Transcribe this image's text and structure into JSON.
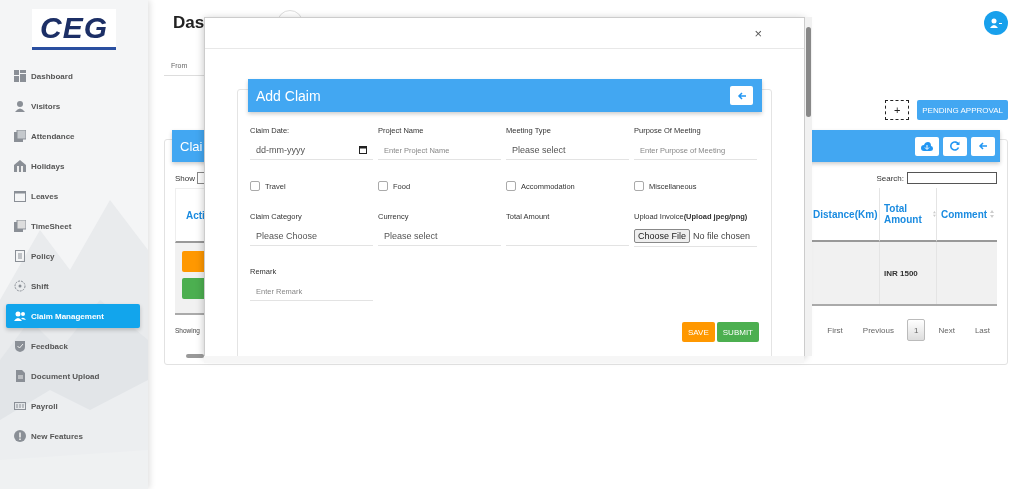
{
  "sidebar": {
    "logo": "CEG",
    "items": [
      {
        "label": "Dashboard",
        "selected": false
      },
      {
        "label": "Visitors",
        "selected": false
      },
      {
        "label": "Attendance",
        "selected": false
      },
      {
        "label": "Holidays",
        "selected": false
      },
      {
        "label": "Leaves",
        "selected": false
      },
      {
        "label": "TimeSheet",
        "selected": false
      },
      {
        "label": "Policy",
        "selected": false
      },
      {
        "label": "Shift",
        "selected": false
      },
      {
        "label": "Claim Management",
        "selected": true
      },
      {
        "label": "Feedback",
        "selected": false
      },
      {
        "label": "Document Upload",
        "selected": false
      },
      {
        "label": "Payroll",
        "selected": false
      },
      {
        "label": "New Features",
        "selected": false
      }
    ]
  },
  "page": {
    "title": "Das",
    "filter_label": "From",
    "add_button": "+",
    "pending_button": "PENDING APPROVAL",
    "card": {
      "title": "Clai",
      "show_label": "Show",
      "search_label": "Search:",
      "left_column": "Acti",
      "columns": [
        "Distance(Km)",
        "Total Amount",
        "Comment"
      ],
      "rows": [
        {
          "total_amount": "INR 1500"
        }
      ],
      "showing": "Showing",
      "pagination": [
        {
          "label": "First",
          "selected": false
        },
        {
          "label": "Previous",
          "selected": false
        },
        {
          "label": "1",
          "selected": true
        },
        {
          "label": "Next",
          "selected": false
        },
        {
          "label": "Last",
          "selected": false
        }
      ]
    }
  },
  "modal": {
    "close": "×",
    "title": "Add Claim",
    "rows": [
      {
        "fields": [
          {
            "kind": "date",
            "label": "Claim Date:",
            "value": "dd-mm-yyyy"
          },
          {
            "kind": "text",
            "label": "Project Name",
            "placeholder": "Enter Project Name"
          },
          {
            "kind": "select",
            "label": "Meeting Type",
            "value": "Please select"
          },
          {
            "kind": "text",
            "label": "Purpose Of Meeting",
            "placeholder": "Enter Purpose of Meeting"
          }
        ]
      },
      {
        "fields": [
          {
            "kind": "checkbox",
            "label": "Travel",
            "checked": false
          },
          {
            "kind": "checkbox",
            "label": "Food",
            "checked": false
          },
          {
            "kind": "checkbox",
            "label": "Accommodation",
            "checked": false
          },
          {
            "kind": "checkbox",
            "label": "Miscellaneous",
            "checked": false
          }
        ]
      },
      {
        "fields": [
          {
            "kind": "select",
            "label": "Claim Category",
            "value": "Please Choose"
          },
          {
            "kind": "select",
            "label": "Currency",
            "value": "Please select"
          },
          {
            "kind": "text",
            "label": "Total Amount"
          },
          {
            "kind": "file",
            "label": "Upload Invoice**(Upload jpeg/png)**",
            "button": "Choose File",
            "status": "No file chosen"
          }
        ]
      },
      {
        "fields": [
          {
            "kind": "text",
            "label": "Remark",
            "placeholder": "Enter Remark"
          }
        ]
      }
    ],
    "buttons": [
      {
        "label": "SAVE",
        "kind": "save"
      },
      {
        "label": "SUBMIT",
        "kind": "submit"
      }
    ]
  }
}
